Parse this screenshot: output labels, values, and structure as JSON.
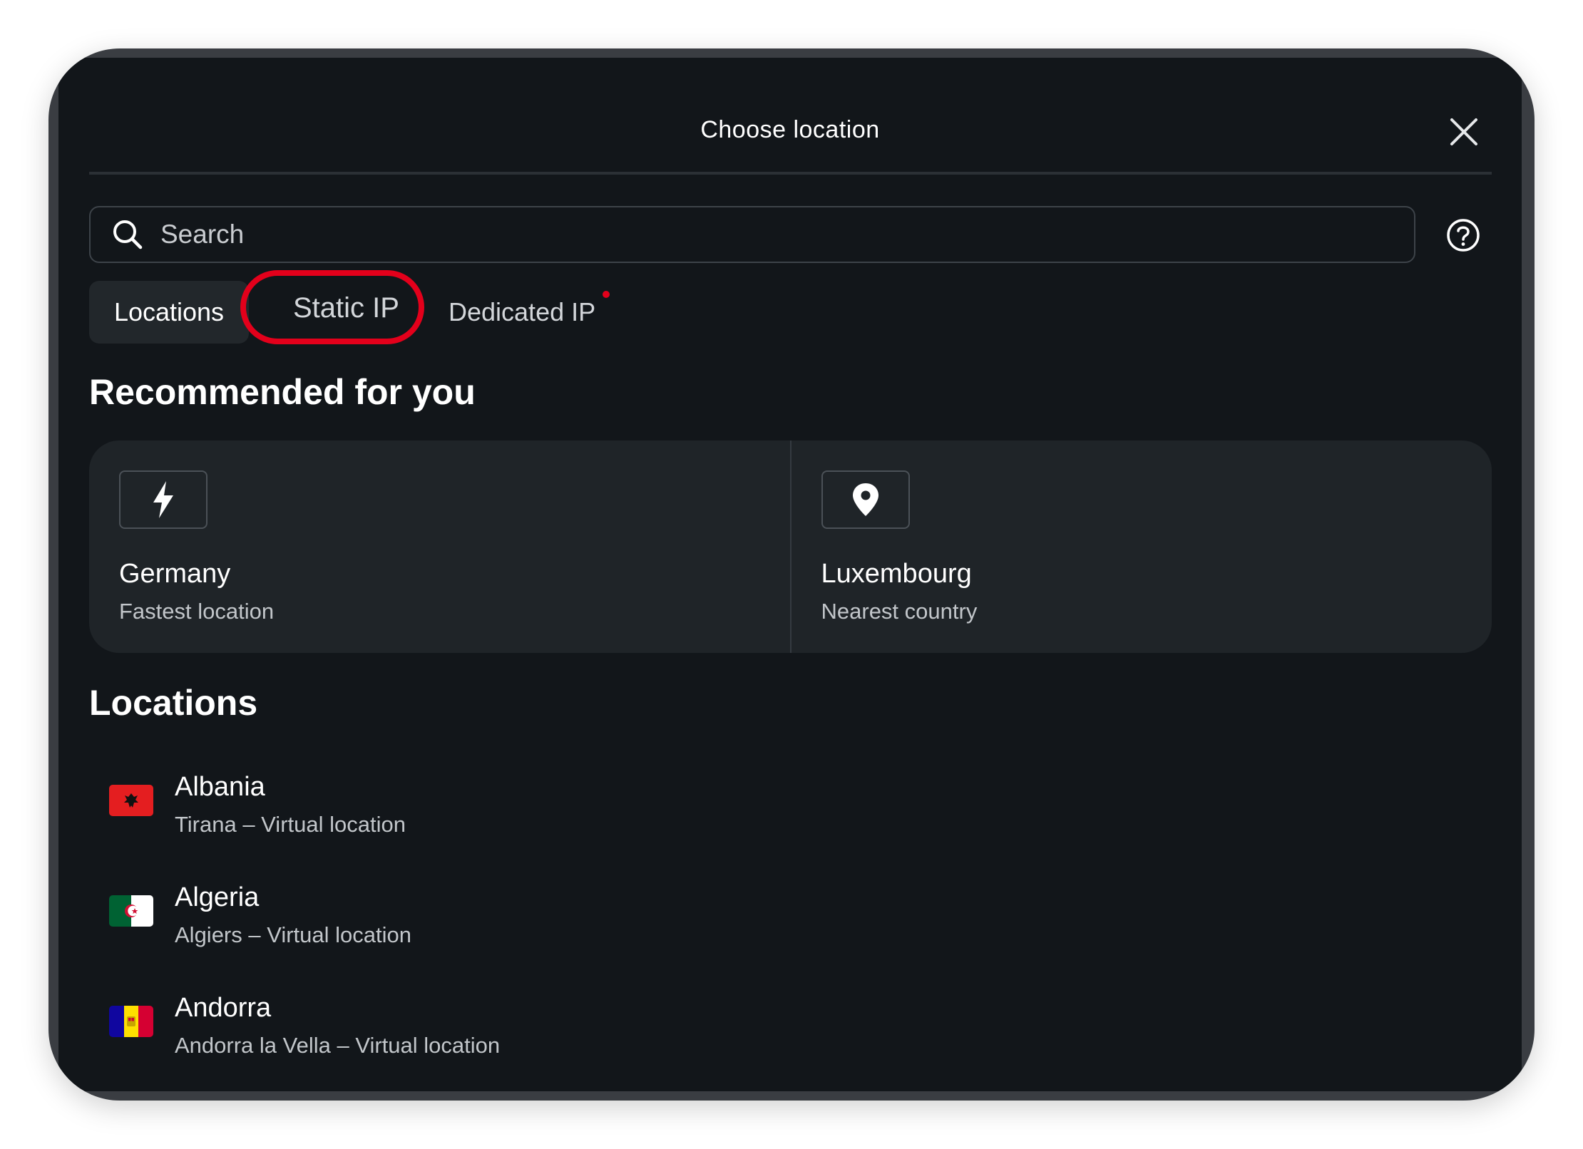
{
  "header": {
    "title": "Choose location"
  },
  "search": {
    "placeholder": "Search"
  },
  "tabs": [
    {
      "label": "Locations",
      "selected": true
    },
    {
      "label": "Static IP",
      "highlighted": true
    },
    {
      "label": "Dedicated IP",
      "has_notification": true
    }
  ],
  "recommended": {
    "title": "Recommended for you",
    "items": [
      {
        "name": "Germany",
        "subtitle": "Fastest location",
        "icon": "lightning-icon"
      },
      {
        "name": "Luxembourg",
        "subtitle": "Nearest country",
        "icon": "location-pin-icon"
      }
    ]
  },
  "locations": {
    "title": "Locations",
    "items": [
      {
        "name": "Albania",
        "subtitle": "Tirana – Virtual location",
        "flag": "albania-flag"
      },
      {
        "name": "Algeria",
        "subtitle": "Algiers – Virtual location",
        "flag": "algeria-flag"
      },
      {
        "name": "Andorra",
        "subtitle": "Andorra la Vella – Virtual location",
        "flag": "andorra-flag"
      }
    ]
  },
  "colors": {
    "background": "#12161a",
    "card": "#1f2428",
    "highlight": "#e3001b",
    "notification_dot": "#e3001b"
  }
}
